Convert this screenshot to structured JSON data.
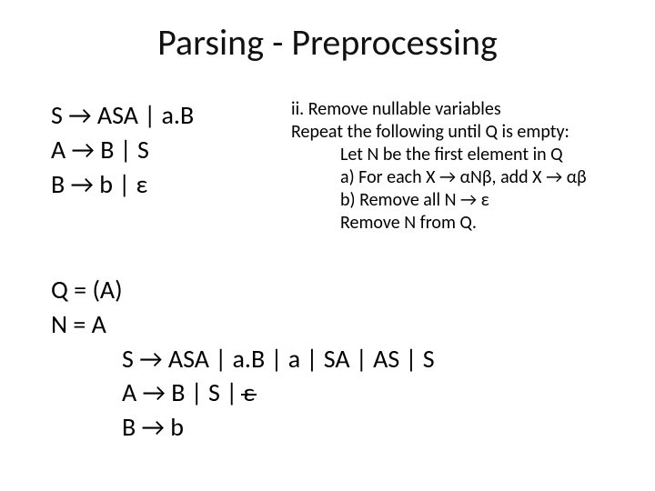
{
  "title": "Parsing - Preprocessing",
  "grammar_initial": {
    "rule_s": "S → ASA | a.B",
    "rule_a": "A → B | S",
    "rule_b": "B → b | ε"
  },
  "algorithm": {
    "heading": "ii. Remove nullable variables",
    "repeat_line": "Repeat the following until Q is empty:",
    "step_let": "Let N be the first element in Q",
    "step_a": "a) For each X → αNβ, add X → αβ",
    "step_b": "b) Remove all N → ε",
    "step_remove": "Remove N from Q."
  },
  "trace": {
    "q_line": "Q = (A)",
    "n_line": "N = A",
    "result_s": "S → ASA | a.B | a | SA | AS | S",
    "result_a_prefix": "A → B | S | ",
    "result_a_strike": "ε",
    "result_b": "B → b"
  }
}
